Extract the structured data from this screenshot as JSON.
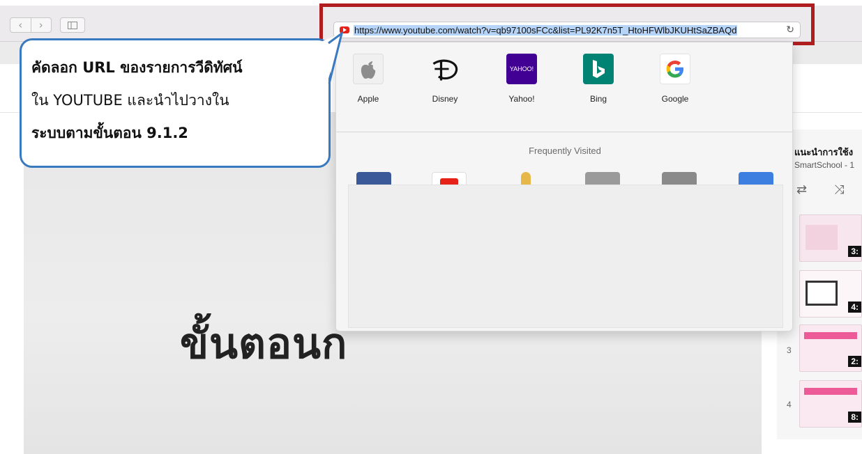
{
  "browser": {
    "address_url": "https://www.youtube.com/watch?v=qb97100sFCc&list=PL92K7n5T_HtoHFWlbJKUHtSaZBAQd",
    "nav_back_icon": "chevron-left-icon",
    "nav_forward_icon": "chevron-right-icon",
    "sidebar_icon": "sidebar-icon",
    "reload_icon": "reload-icon"
  },
  "favorites": [
    {
      "label": "Apple",
      "icon": "apple-icon"
    },
    {
      "label": "Disney",
      "icon": "disney-icon"
    },
    {
      "label": "Yahoo!",
      "icon": "yahoo-icon",
      "tile_text": "YAHOO!"
    },
    {
      "label": "Bing",
      "icon": "bing-icon"
    },
    {
      "label": "Google",
      "icon": "google-icon"
    }
  ],
  "frequently_visited": {
    "heading": "Frequently Visited",
    "tiles": [
      {
        "icon": "facebook-icon",
        "color": "#3b5998"
      },
      {
        "icon": "youtube-icon",
        "color": "#e62117"
      },
      {
        "icon": "emblem-icon",
        "color": "#e6b84a"
      },
      {
        "icon": "site-icon",
        "color": "#9a9a9a"
      },
      {
        "icon": "site-icon",
        "color": "#8a8a8a"
      },
      {
        "icon": "site-icon",
        "color": "#3d7fe0"
      }
    ]
  },
  "callout": {
    "lines": [
      "คัดลอก URL ของรายการวีดิทัศน์",
      "ใน YOUTUBE และนำไปวางใน",
      "ระบบตามขั้นตอน 9.1.2"
    ]
  },
  "video": {
    "title_visible": "ขั้นตอนก"
  },
  "playlist": {
    "title": "แนะนำการใช้ง",
    "subtitle": "SmartSchool - 1",
    "items": [
      {
        "index": "",
        "duration": "3:"
      },
      {
        "index": "",
        "duration": "4:"
      },
      {
        "index": "3",
        "duration": "2:"
      },
      {
        "index": "4",
        "duration": "8:"
      }
    ]
  },
  "colors": {
    "highlight_box": "#b01d1f",
    "callout_border": "#3979bf",
    "url_selection": "#b5d4f7"
  }
}
